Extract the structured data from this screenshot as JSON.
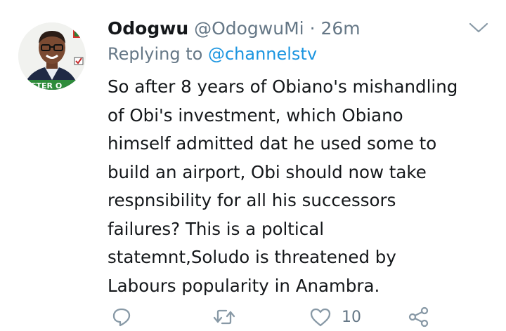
{
  "tweet": {
    "display_name": "Odogwu",
    "handle": "@OdogwuMi",
    "separator": "·",
    "time": "26m",
    "reply_prefix": "Replying to",
    "reply_to": "@channelstv",
    "text_lines": [
      "So after 8 years of Obiano's mishandling",
      "of Obi's investment, which Obiano",
      "himself admitted dat he used some to",
      "build an airport, Obi should now take",
      "respnsibility for all his successors",
      "failures? This is a poltical",
      "statemnt,Soludo is threatened by",
      "Labours popularity in Anambra."
    ],
    "avatar_banner_text": "ETER O",
    "actions": {
      "reply_icon": "reply-icon",
      "retweet_icon": "retweet-icon",
      "like_icon": "like-icon",
      "like_count": "10",
      "share_icon": "share-icon"
    },
    "colors": {
      "text": "#14171a",
      "secondary": "#657786",
      "link": "#1b95e0"
    }
  }
}
